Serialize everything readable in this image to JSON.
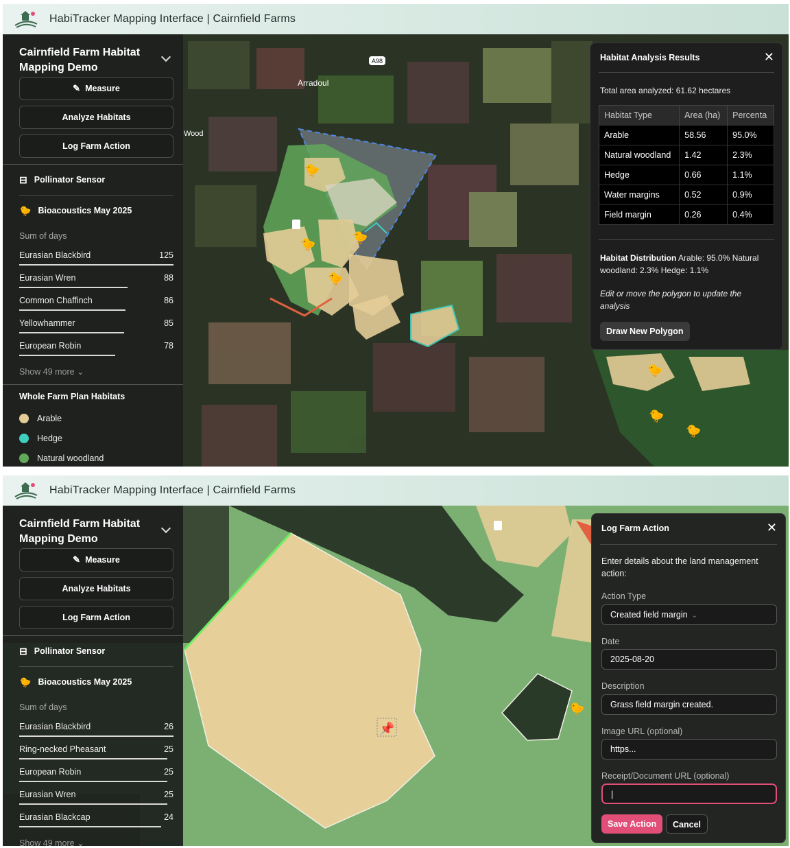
{
  "app": {
    "title": "HabiTracker Mapping Interface | Cairnfield Farms"
  },
  "colors": {
    "arable": "#e3cc97",
    "hedge": "#3fcfbf",
    "natural_woodland": "#62a85a",
    "accent_pink": "#e14f78",
    "analysis_outline": "#4f86e6"
  },
  "sidebar": {
    "title": "Cairnfield Farm Habitat Mapping Demo",
    "buttons": {
      "measure": "Measure",
      "analyze": "Analyze Habitats",
      "log": "Log Farm Action"
    },
    "sensor": "Pollinator Sensor",
    "bioacoustics": "Bioacoustics May 2025",
    "sum_label": "Sum of days"
  },
  "view1": {
    "map_labels": {
      "road": "A98",
      "village": "Arradoul",
      "wood": "Wood"
    },
    "species": [
      {
        "name": "Eurasian Blackbird",
        "value": "125",
        "fraction": 1.0
      },
      {
        "name": "Eurasian Wren",
        "value": "88",
        "fraction": 0.7
      },
      {
        "name": "Common Chaffinch",
        "value": "86",
        "fraction": 0.69
      },
      {
        "name": "Yellowhammer",
        "value": "85",
        "fraction": 0.68
      },
      {
        "name": "European Robin",
        "value": "78",
        "fraction": 0.62
      }
    ],
    "show_more": "Show 49 more ⌄",
    "legend_title": "Whole Farm Plan Habitats",
    "legend": [
      {
        "label": "Arable",
        "color": "#e3cc97"
      },
      {
        "label": "Hedge",
        "color": "#3fcfbf"
      },
      {
        "label": "Natural woodland",
        "color": "#62a85a"
      }
    ],
    "analysis": {
      "title": "Habitat Analysis Results",
      "total": "Total area analyzed: 61.62 hectares",
      "columns": [
        "Habitat Type",
        "Area (ha)",
        "Percenta"
      ],
      "rows": [
        [
          "Arable",
          "58.56",
          "95.0%"
        ],
        [
          "Natural woodland",
          "1.42",
          "2.3%"
        ],
        [
          "Hedge",
          "0.66",
          "1.1%"
        ],
        [
          "Water margins",
          "0.52",
          "0.9%"
        ],
        [
          "Field margin",
          "0.26",
          "0.4%"
        ]
      ],
      "distribution_label": "Habitat Distribution",
      "distribution_text": " Arable: 95.0% Natural woodland: 2.3% Hedge: 1.1%",
      "hint": "Edit or move the polygon to update the analysis",
      "draw_button": "Draw New Polygon"
    }
  },
  "view2": {
    "species": [
      {
        "name": "Eurasian Blackbird",
        "value": "26",
        "fraction": 1.0
      },
      {
        "name": "Ring-necked Pheasant",
        "value": "25",
        "fraction": 0.96
      },
      {
        "name": "European Robin",
        "value": "25",
        "fraction": 0.96
      },
      {
        "name": "Eurasian Wren",
        "value": "25",
        "fraction": 0.96
      },
      {
        "name": "Eurasian Blackcap",
        "value": "24",
        "fraction": 0.92
      }
    ],
    "show_more": "Show 49 more ⌄",
    "log": {
      "title": "Log Farm Action",
      "intro": "Enter details about the land management action:",
      "action_type_label": "Action Type",
      "action_type_value": "Created field margin",
      "date_label": "Date",
      "date_value": "2025-08-20",
      "description_label": "Description",
      "description_value": "Grass field margin created.",
      "image_label": "Image URL (optional)",
      "image_value": "https...",
      "receipt_label": "Receipt/Document URL (optional)",
      "receipt_value": "|",
      "save": "Save Action",
      "cancel": "Cancel"
    }
  },
  "icons": {
    "logo": "farm-logo",
    "measure": "ruler-icon",
    "sensor": "sensor-icon",
    "bird": "bird-icon",
    "close": "close-icon",
    "pin": "pushpin-icon",
    "chevron": "chevron-down-icon"
  }
}
